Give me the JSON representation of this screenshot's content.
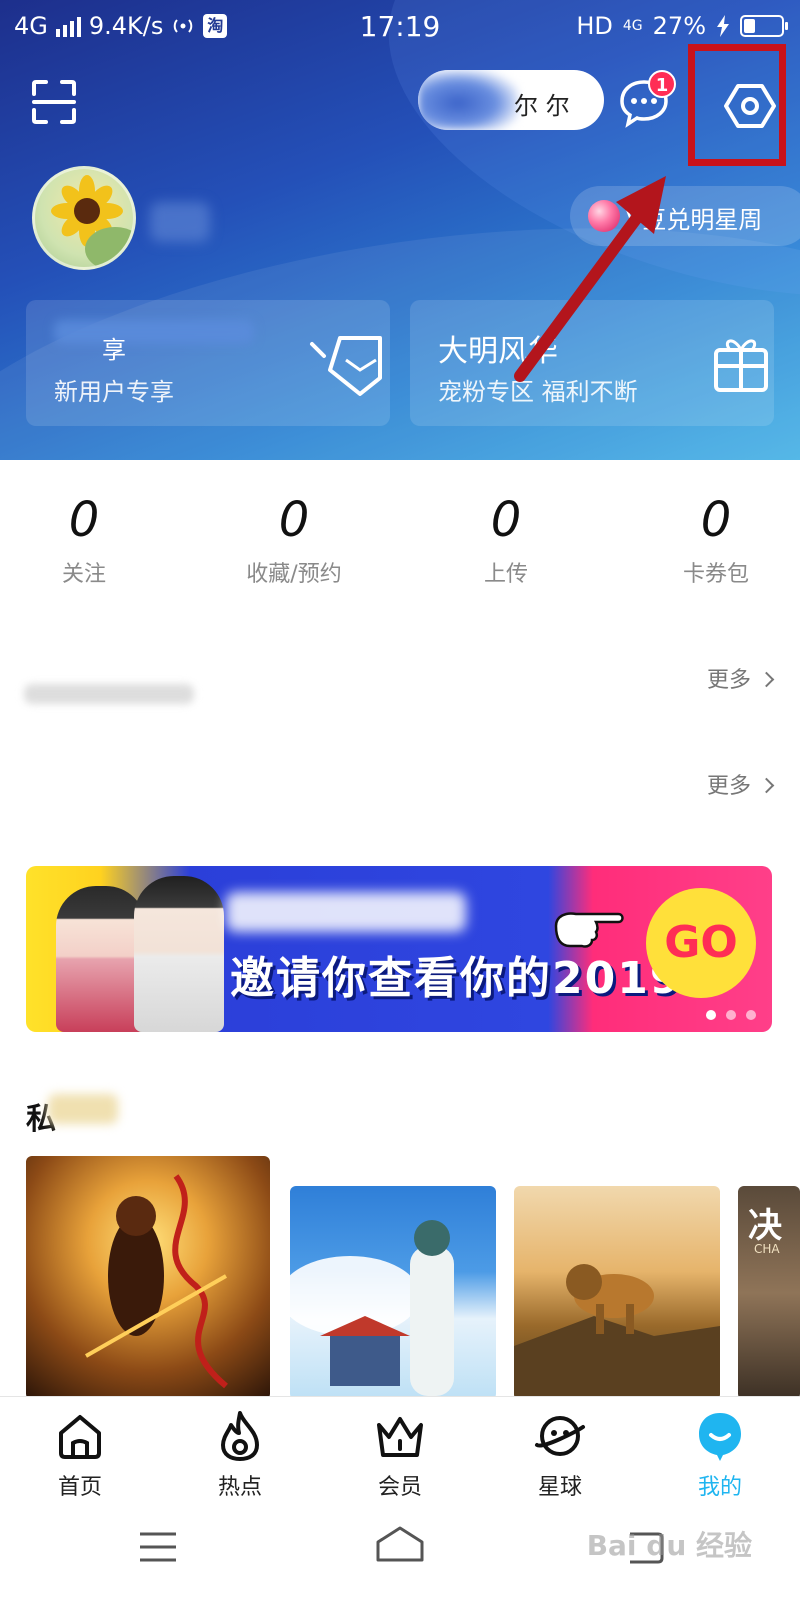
{
  "status_bar": {
    "network": "4G",
    "speed": "9.4K/s",
    "time": "17:19",
    "hd": "HD",
    "net_small": "4G",
    "battery_pct": "27%",
    "battery_level": 0.27,
    "taobao_glyph": "淘"
  },
  "header": {
    "pill_text": "尔 尔",
    "msg_badge": "1",
    "points_chip": "V豆兑明星周",
    "cards": [
      {
        "title": "享",
        "subtitle": "新用户专享"
      },
      {
        "title": "大明风华",
        "subtitle": "宠粉专区 福利不断"
      }
    ],
    "icons": [
      "scan-icon",
      "chat-bubble-icon",
      "settings-hex-icon",
      "gem-icon",
      "gift-icon"
    ]
  },
  "stats": [
    {
      "value": "0",
      "label": "关注"
    },
    {
      "value": "0",
      "label": "收藏/预约"
    },
    {
      "value": "0",
      "label": "上传"
    },
    {
      "value": "0",
      "label": "卡券包"
    }
  ],
  "sections": {
    "more_1": "更多",
    "more_2": "更多"
  },
  "banner": {
    "title": "邀请你查看你的2019",
    "go": "GO"
  },
  "recommend": {
    "title_char": "私",
    "poster4_text": "决",
    "poster4_sub": "CHA"
  },
  "tabbar": [
    {
      "label": "首页",
      "icon": "home-icon"
    },
    {
      "label": "热点",
      "icon": "flame-icon"
    },
    {
      "label": "会员",
      "icon": "crown-icon"
    },
    {
      "label": "星球",
      "icon": "planet-icon"
    },
    {
      "label": "我的",
      "icon": "profile-bubble-icon"
    }
  ],
  "colors": {
    "accent": "#1fb5f0",
    "badge": "#ff2d55",
    "highlight_box": "#c8121a",
    "arrow": "#b3151c"
  },
  "watermark": "Bai du 经验"
}
